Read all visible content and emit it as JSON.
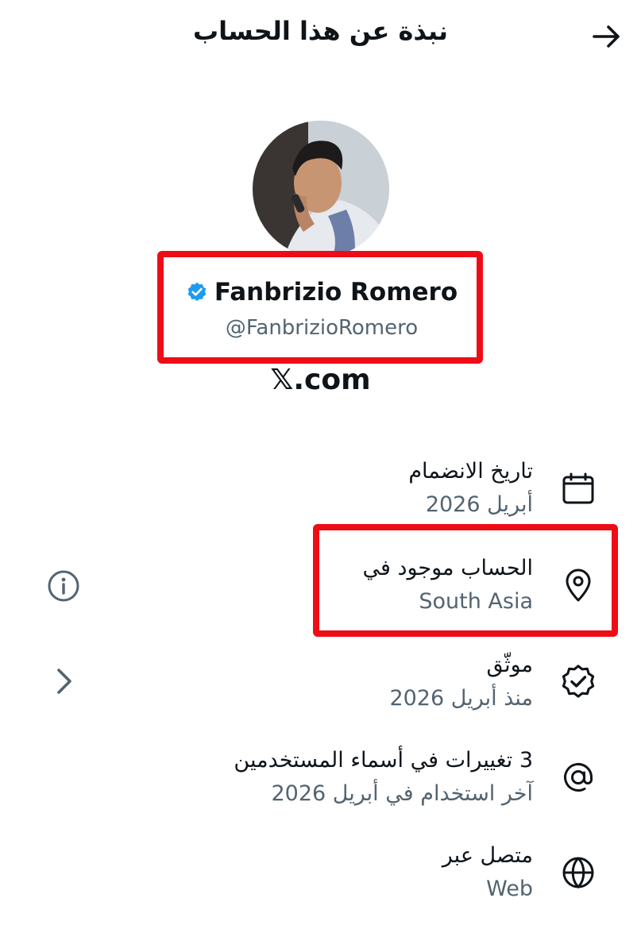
{
  "header": {
    "title": "نبذة عن هذا الحساب"
  },
  "profile": {
    "name": "Fanbrizio Romero",
    "handle": "@FanbrizioRomero",
    "site": "𝕏.com"
  },
  "rows": [
    {
      "icon": "calendar-icon",
      "title": "تاريخ الانضمام",
      "sub": "أبريل 2026"
    },
    {
      "icon": "location-pin-icon",
      "title": "الحساب موجود في",
      "sub": "South Asia"
    },
    {
      "icon": "verified-badge-icon",
      "title": "موثّق",
      "sub": "منذ أبريل 2026"
    },
    {
      "icon": "at-sign-icon",
      "title": "3 تغييرات في أسماء المستخدمين",
      "sub": "آخر استخدام في أبريل 2026"
    },
    {
      "icon": "globe-icon",
      "title": "متصل عبر",
      "sub": "Web"
    }
  ],
  "colors": {
    "highlight": "#ee0d17",
    "verified": "#1d9bf0",
    "secondary_text": "#536471"
  }
}
